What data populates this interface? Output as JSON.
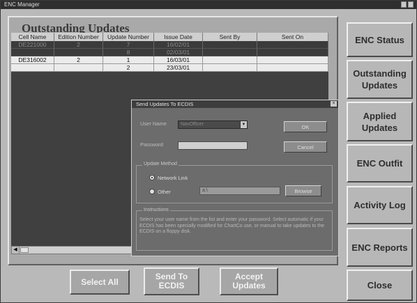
{
  "window": {
    "title": "ENC Manager"
  },
  "panel": {
    "title": "Outstanding Updates"
  },
  "grid": {
    "columns": [
      "Cell Name",
      "Edition Number",
      "Update Number",
      "Issue Date",
      "Sent By",
      "Sent On"
    ],
    "rows": [
      {
        "style": "dark",
        "cells": [
          "DE221000",
          "2",
          "7",
          "16/02/01",
          "",
          ""
        ]
      },
      {
        "style": "dark",
        "cells": [
          "",
          "",
          "8",
          "02/03/01",
          "",
          ""
        ]
      },
      {
        "style": "light",
        "cells": [
          "DE316002",
          "2",
          "1",
          "16/03/01",
          "",
          ""
        ]
      },
      {
        "style": "light",
        "cells": [
          "",
          "",
          "2",
          "23/03/01",
          "",
          ""
        ]
      }
    ]
  },
  "bottom_buttons": {
    "select_all": "Select All",
    "send_to_ecdis_1": "Send To",
    "send_to_ecdis_2": "ECDIS",
    "accept_updates_1": "Accept",
    "accept_updates_2": "Updates"
  },
  "nav": {
    "enc_status": "ENC Status",
    "outstanding_1": "Outstanding",
    "outstanding_2": "Updates",
    "applied_1": "Applied",
    "applied_2": "Updates",
    "enc_outfit": "ENC Outfit",
    "activity_log": "Activity Log",
    "enc_reports": "ENC Reports",
    "close": "Close"
  },
  "dialog": {
    "title": "Send Updates To ECDIS",
    "user_name_label": "User Name",
    "user_name_value": "NavOfficer",
    "password_label": "Password",
    "password_value": "",
    "ok": "OK",
    "cancel": "Cancel",
    "update_method": {
      "label": "Update Method",
      "network_link": "Network Link",
      "other": "Other",
      "other_path": "a:\\",
      "browse": "Browse",
      "selected": "network_link"
    },
    "instructions": {
      "label": "Instructions",
      "text": "Select your user name from the list and enter your password. Select automatic if your ECDIS has been specially modified for ChartCo use, or manual to take updates to the ECDIS on a floppy disk."
    }
  },
  "colors": {
    "window_bg": "#b9b9b9",
    "grid_dark": "#3b3b3b",
    "grid_light": "#ebebeb",
    "dialog_bg": "#6c6c6c"
  }
}
